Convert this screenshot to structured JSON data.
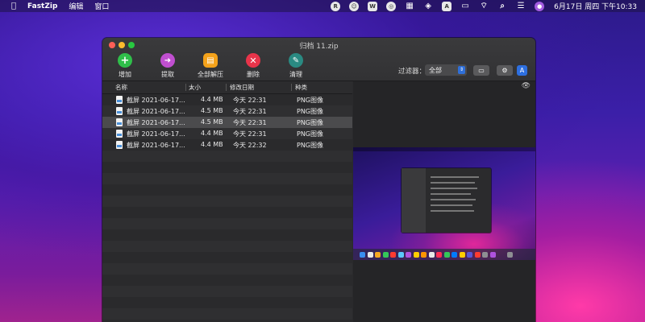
{
  "menubar": {
    "app_name": "FastZip",
    "menus": [
      "编辑",
      "窗口"
    ],
    "status_icons": [
      "r-icon",
      "face-icon",
      "w-icon",
      "sync-icon",
      "grid-icon",
      "layers-icon",
      "a-icon",
      "battery-icon",
      "wifi-icon",
      "search-icon",
      "control-center-icon",
      "siri-icon"
    ],
    "clock": "6月17日 周四 下午10:33"
  },
  "window": {
    "title": "归档 11.zip",
    "toolbar": [
      {
        "label": "增加",
        "icon": "plus-icon",
        "color": "#2fbf4a"
      },
      {
        "label": "提取",
        "icon": "extract-icon",
        "color": "#c04fd0"
      },
      {
        "label": "全部解压",
        "icon": "archive-icon",
        "color": "#f4a21a"
      },
      {
        "label": "删除",
        "icon": "delete-icon",
        "color": "#e8344a"
      },
      {
        "label": "清理",
        "icon": "clean-icon",
        "color": "#2a8a82"
      }
    ],
    "filter": {
      "label": "过滤器：",
      "value": "全部"
    },
    "columns": {
      "name": "名称",
      "size": "大小",
      "modified": "修改日期",
      "kind": "种类"
    },
    "files": [
      {
        "name": "截屏 2021-06-17...",
        "size": "4.4 MB",
        "date": "今天 22:31",
        "kind": "PNG图像",
        "selected": false
      },
      {
        "name": "截屏 2021-06-17...",
        "size": "4.5 MB",
        "date": "今天 22:31",
        "kind": "PNG图像",
        "selected": false
      },
      {
        "name": "截屏 2021-06-17...",
        "size": "4.5 MB",
        "date": "今天 22:31",
        "kind": "PNG图像",
        "selected": true
      },
      {
        "name": "截屏 2021-06-17...",
        "size": "4.4 MB",
        "date": "今天 22:31",
        "kind": "PNG图像",
        "selected": false
      },
      {
        "name": "截屏 2021-06-17...",
        "size": "4.4 MB",
        "date": "今天 22:32",
        "kind": "PNG图像",
        "selected": false
      }
    ]
  }
}
